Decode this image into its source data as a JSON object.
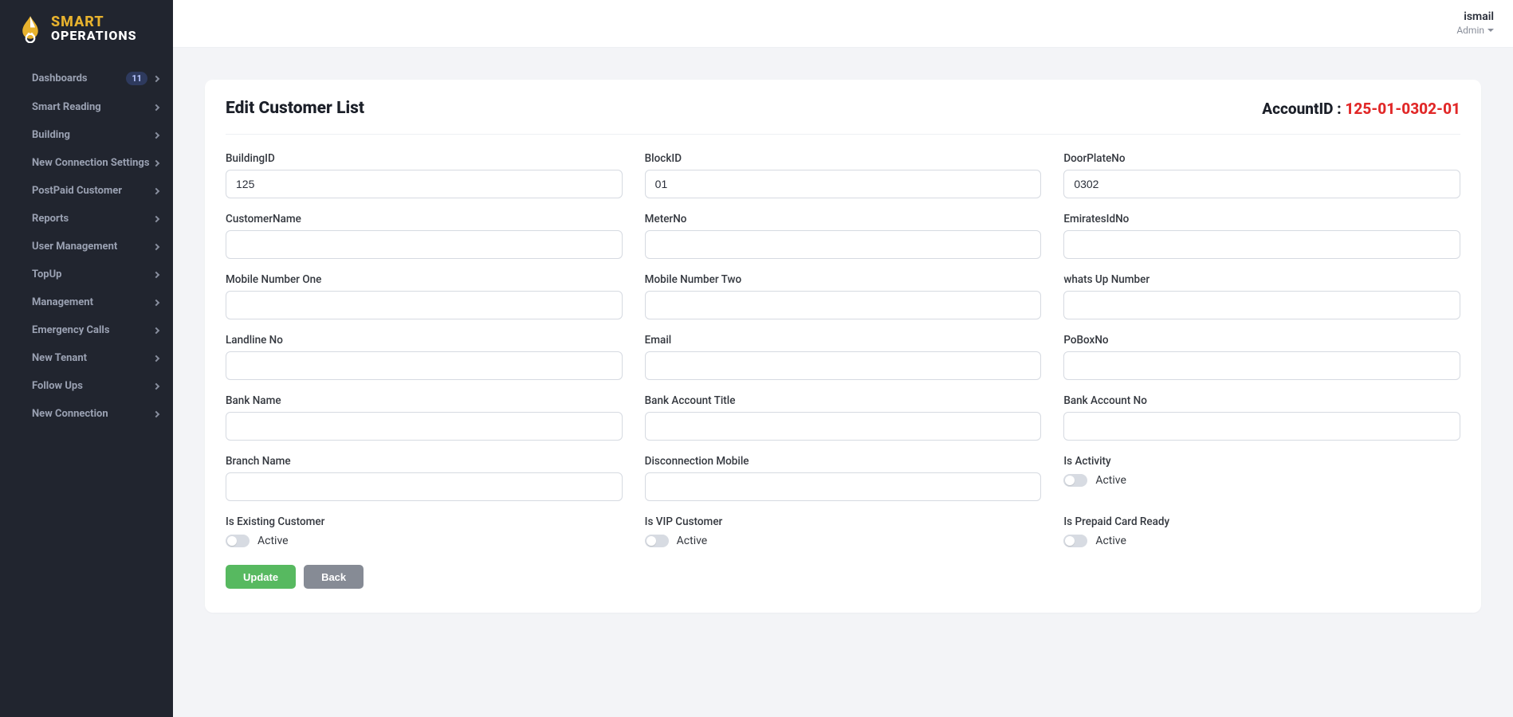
{
  "logo": {
    "top": "SMART",
    "bottom": "OPERATIONS"
  },
  "sidebar": {
    "items": [
      {
        "label": "Dashboards",
        "badge": "11"
      },
      {
        "label": "Smart Reading"
      },
      {
        "label": "Building"
      },
      {
        "label": "New Connection Settings"
      },
      {
        "label": "PostPaid Customer"
      },
      {
        "label": "Reports"
      },
      {
        "label": "User Management"
      },
      {
        "label": "TopUp"
      },
      {
        "label": "Management"
      },
      {
        "label": "Emergency Calls"
      },
      {
        "label": "New Tenant"
      },
      {
        "label": "Follow Ups"
      },
      {
        "label": "New Connection"
      }
    ]
  },
  "user": {
    "name": "ismail",
    "role": "Admin"
  },
  "page": {
    "title": "Edit Customer List",
    "accountLabel": "AccountID : ",
    "accountId": "125-01-0302-01"
  },
  "form": {
    "buildingId": {
      "label": "BuildingID",
      "value": "125"
    },
    "blockId": {
      "label": "BlockID",
      "value": "01"
    },
    "doorPlateNo": {
      "label": "DoorPlateNo",
      "value": "0302"
    },
    "customerName": {
      "label": "CustomerName",
      "value": ""
    },
    "meterNo": {
      "label": "MeterNo",
      "value": ""
    },
    "emiratesId": {
      "label": "EmiratesIdNo",
      "value": ""
    },
    "mobile1": {
      "label": "Mobile Number One",
      "value": ""
    },
    "mobile2": {
      "label": "Mobile Number Two",
      "value": ""
    },
    "whatsUp": {
      "label": "whats Up Number",
      "value": ""
    },
    "landline": {
      "label": "Landline No",
      "value": ""
    },
    "email": {
      "label": "Email",
      "value": ""
    },
    "pobox": {
      "label": "PoBoxNo",
      "value": ""
    },
    "bankName": {
      "label": "Bank Name",
      "value": ""
    },
    "bankTitle": {
      "label": "Bank Account Title",
      "value": ""
    },
    "bankAccNo": {
      "label": "Bank Account No",
      "value": ""
    },
    "branchName": {
      "label": "Branch Name",
      "value": ""
    },
    "discMobile": {
      "label": "Disconnection Mobile",
      "value": ""
    },
    "isActivity": {
      "label": "Is Activity",
      "state": "Active"
    },
    "isExisting": {
      "label": "Is Existing Customer",
      "state": "Active"
    },
    "isVip": {
      "label": "Is VIP Customer",
      "state": "Active"
    },
    "isPrepaid": {
      "label": "Is Prepaid Card Ready",
      "state": "Active"
    }
  },
  "buttons": {
    "update": "Update",
    "back": "Back"
  }
}
